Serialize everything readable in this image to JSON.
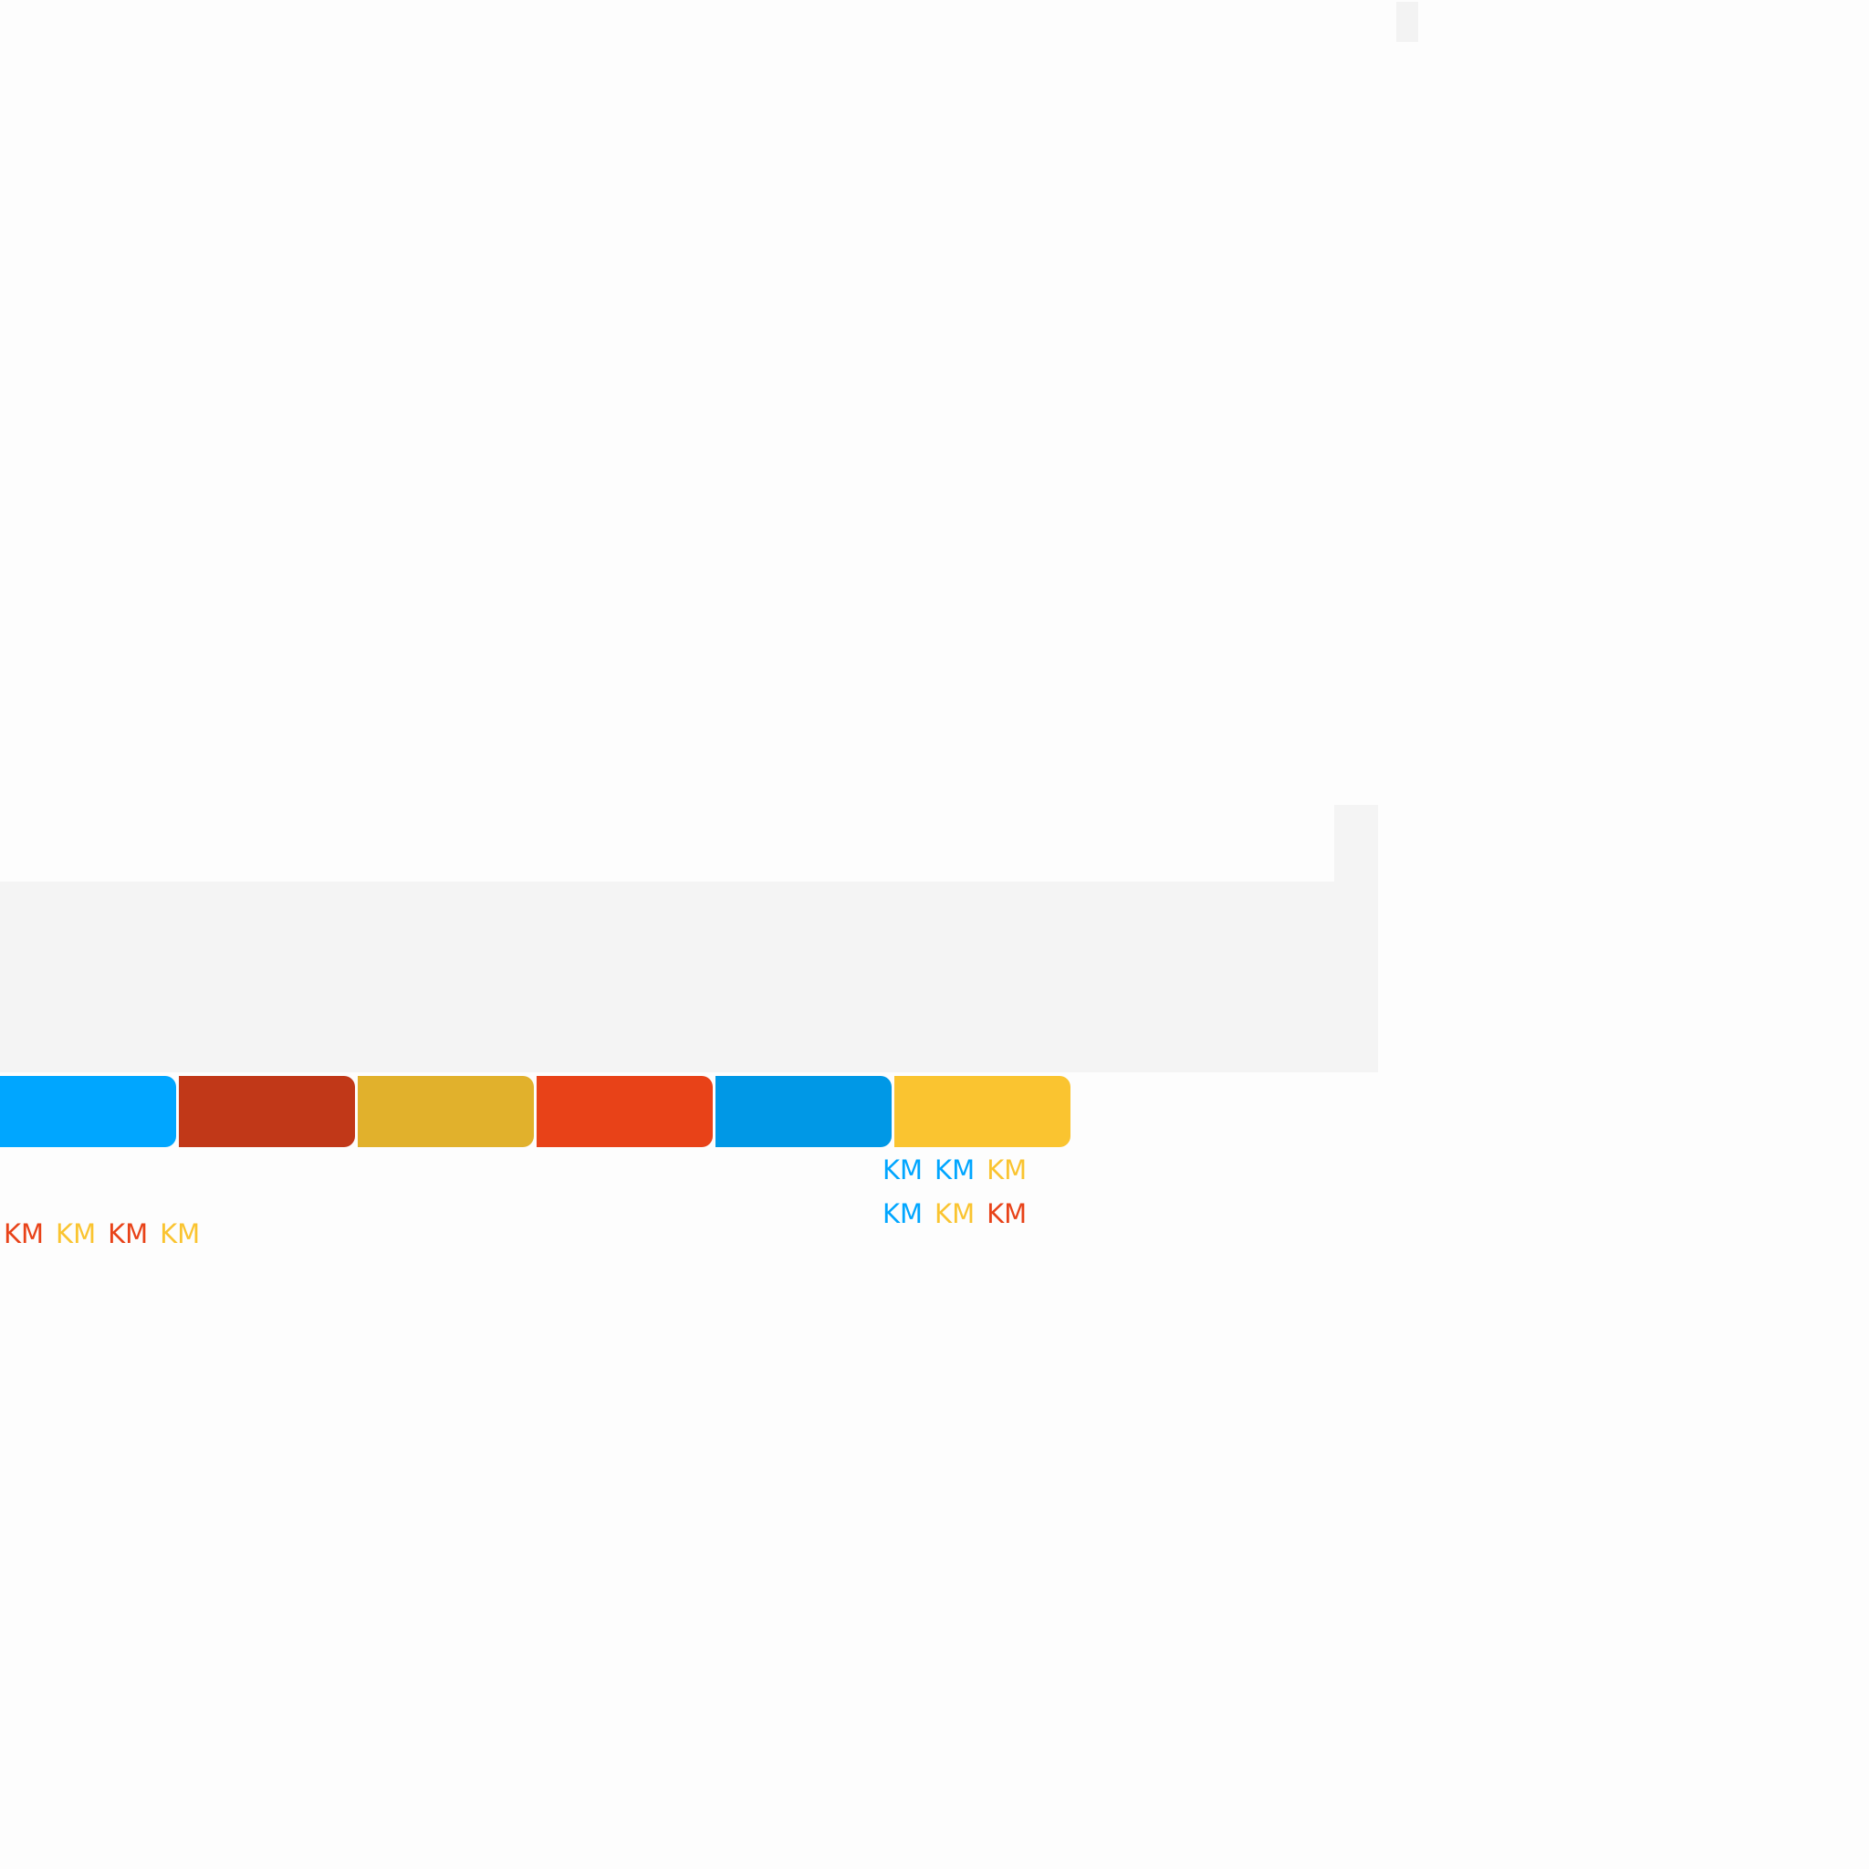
{
  "colors": {
    "page_background": "#fdfdfd",
    "panel_gray": "#f4f4f4",
    "sky_blue": "#00a6ff",
    "rust_red": "#c13818",
    "mustard": "#e1b12c",
    "orange_red": "#e84218",
    "blue": "#0098e6",
    "yellow": "#fac430"
  },
  "swatches": [
    {
      "name": "swatch-sky-blue",
      "color": "#00a6ff"
    },
    {
      "name": "swatch-rust-red",
      "color": "#c13818"
    },
    {
      "name": "swatch-mustard",
      "color": "#e1b12c"
    },
    {
      "name": "swatch-orange-red",
      "color": "#e84218"
    },
    {
      "name": "swatch-blue",
      "color": "#0098e6"
    },
    {
      "name": "swatch-yellow",
      "color": "#fac430"
    }
  ],
  "km_labels_left": [
    {
      "text": "KM",
      "color": "#e84218"
    },
    {
      "text": "KM",
      "color": "#fac430"
    },
    {
      "text": "KM",
      "color": "#e84218"
    },
    {
      "text": "KM",
      "color": "#fac430"
    }
  ],
  "km_labels_right_row1": [
    {
      "text": "KM",
      "color": "#00a6ff"
    },
    {
      "text": "KM",
      "color": "#00a6ff"
    },
    {
      "text": "KM",
      "color": "#fac430"
    }
  ],
  "km_labels_right_row2": [
    {
      "text": "KM",
      "color": "#00a6ff"
    },
    {
      "text": "KM",
      "color": "#fac430"
    },
    {
      "text": "KM",
      "color": "#e84218"
    }
  ]
}
